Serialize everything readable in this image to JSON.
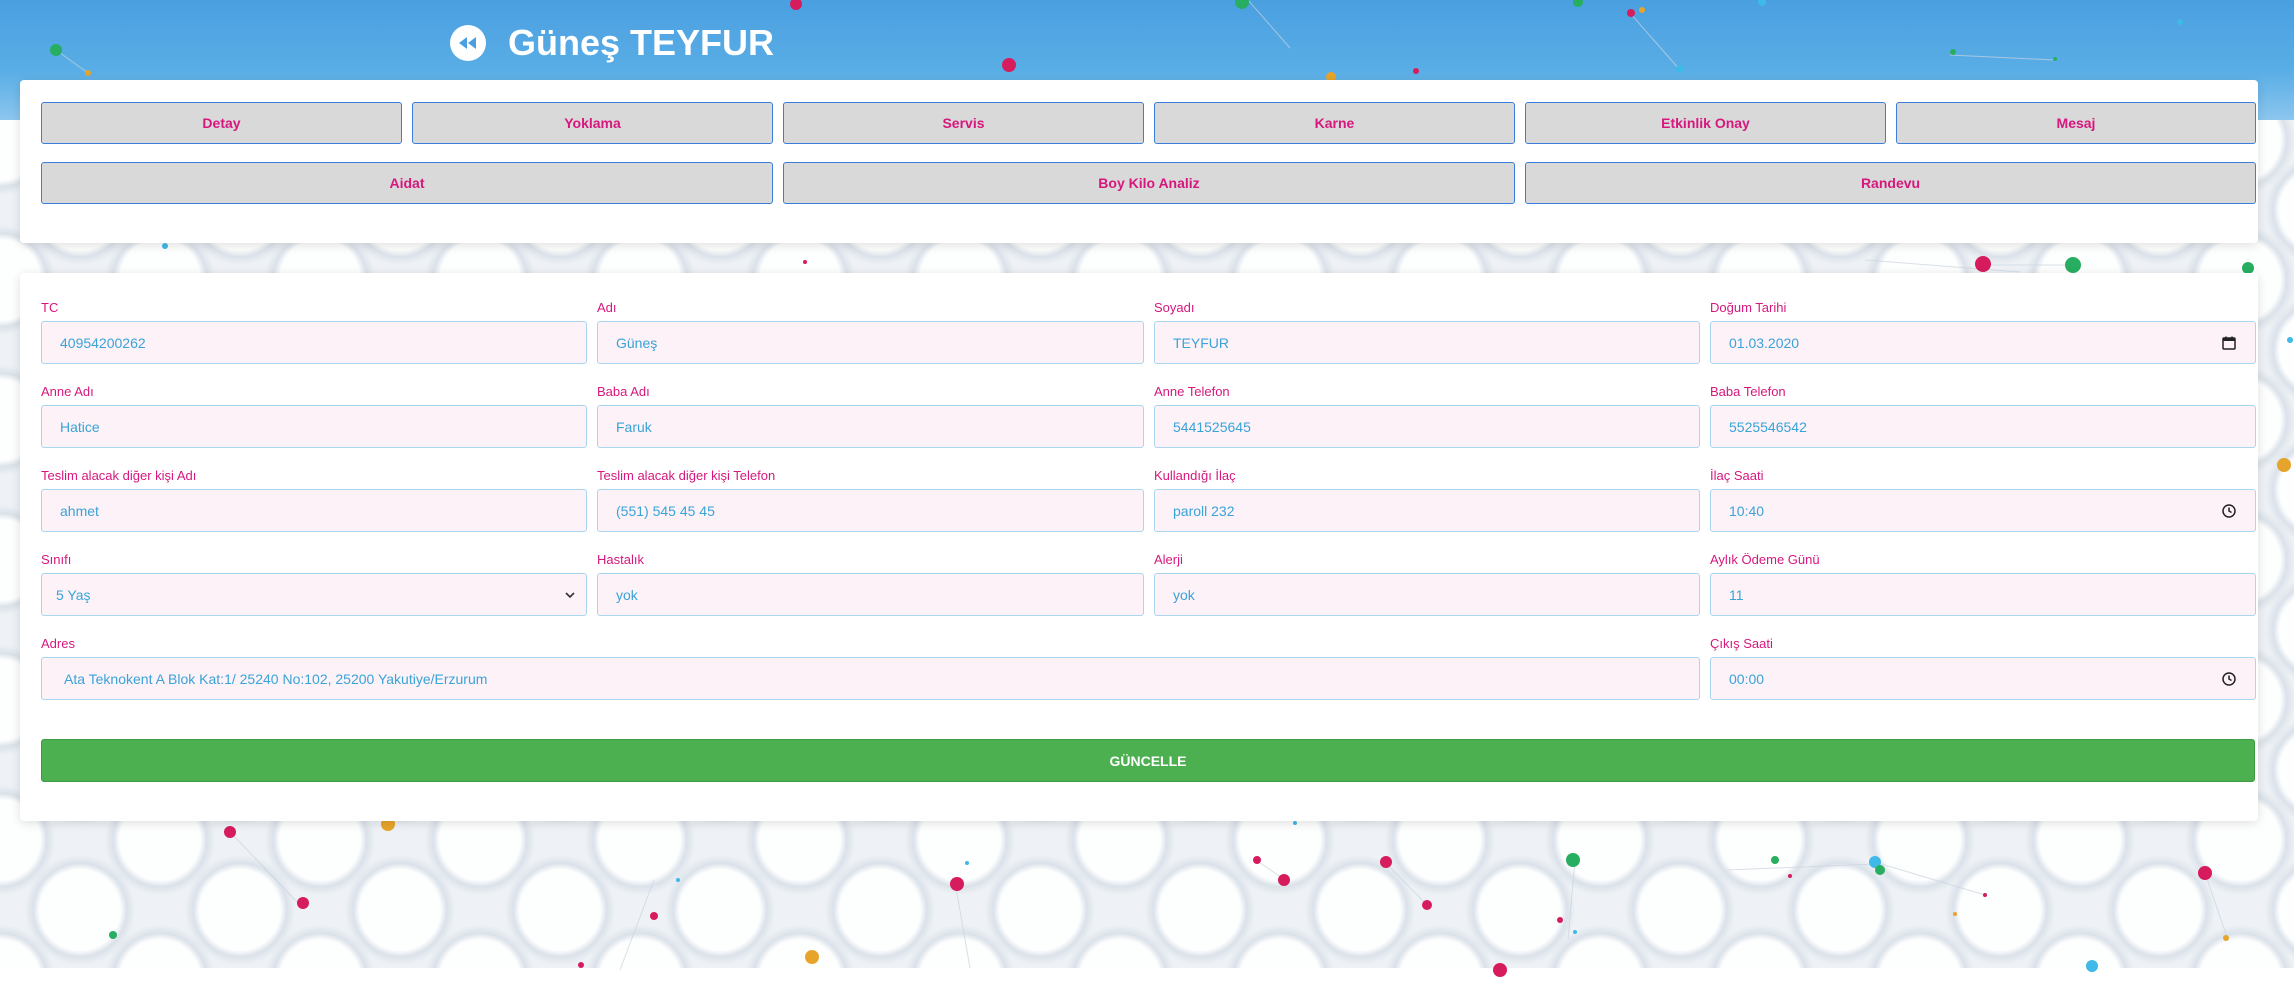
{
  "header": {
    "title": "Güneş TEYFUR"
  },
  "nav": {
    "row1": [
      "Detay",
      "Yoklama",
      "Servis",
      "Karne",
      "Etkinlik Onay",
      "Mesaj"
    ],
    "row2": [
      "Aidat",
      "Boy Kilo Analiz",
      "Randevu"
    ]
  },
  "form": {
    "tc": {
      "label": "TC",
      "value": "40954200262"
    },
    "adi": {
      "label": "Adı",
      "value": "Güneş"
    },
    "soyadi": {
      "label": "Soyadı",
      "value": "TEYFUR"
    },
    "dogum": {
      "label": "Doğum Tarihi",
      "value": "01.03.2020"
    },
    "anne_adi": {
      "label": "Anne Adı",
      "value": "Hatice"
    },
    "baba_adi": {
      "label": "Baba Adı",
      "value": "Faruk"
    },
    "anne_tel": {
      "label": "Anne Telefon",
      "value": "5441525645"
    },
    "baba_tel": {
      "label": "Baba Telefon",
      "value": "5525546542"
    },
    "teslim_adi": {
      "label": "Teslim alacak diğer kişi Adı",
      "value": "ahmet"
    },
    "teslim_tel": {
      "label": "Teslim alacak diğer kişi Telefon",
      "value": "(551) 545 45 45"
    },
    "ilac": {
      "label": "Kullandığı İlaç",
      "value": "paroll 232"
    },
    "ilac_saati": {
      "label": "İlaç Saati",
      "value": "10:40"
    },
    "sinifi": {
      "label": "Sınıfı",
      "value": "5 Yaş"
    },
    "hastalik": {
      "label": "Hastalık",
      "value": "yok"
    },
    "alerji": {
      "label": "Alerji",
      "value": "yok"
    },
    "odeme_gunu": {
      "label": "Aylık Ödeme Günü",
      "value": "11"
    },
    "adres": {
      "label": "Adres",
      "value": "Ata Teknokent A Blok Kat:1/ 25240 No:102, 25200 Yakutiye/Erzurum"
    },
    "cikis_saati": {
      "label": "Çıkış Saati",
      "value": "00:00"
    },
    "submit_label": "GÜNCELLE"
  },
  "icons": {
    "back": "rewind-icon",
    "calendar": "calendar-icon",
    "clock": "clock-icon",
    "select": "chevron-down-icon"
  },
  "colors": {
    "header": "#4a9fe0",
    "accent_text": "#d6187e",
    "button_border": "#3b7dd8",
    "input_bg": "#fcf2f7",
    "input_text": "#3aa3d8",
    "submit": "#4caf50"
  }
}
